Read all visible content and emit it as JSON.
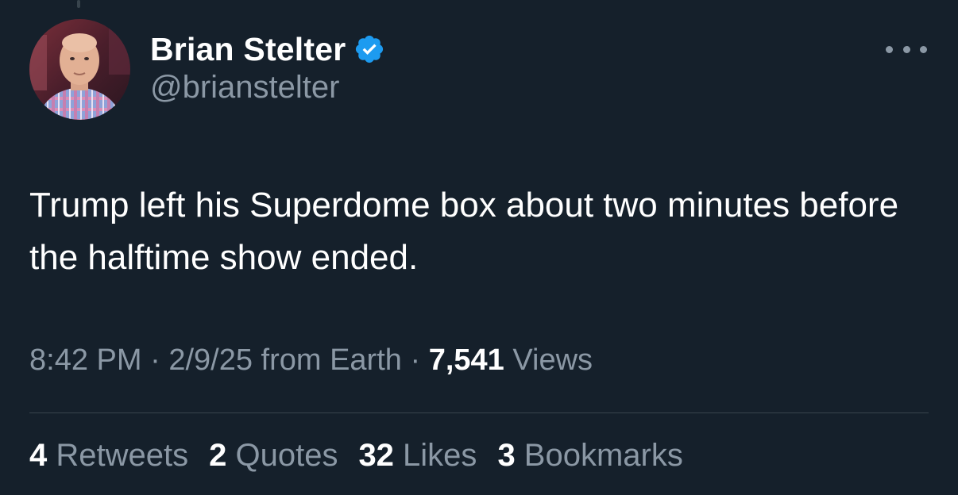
{
  "author": {
    "display_name": "Brian Stelter",
    "handle": "@brianstelter",
    "verified": true
  },
  "tweet": {
    "text": "Trump left his Superdome box about two minutes before the halftime show ended."
  },
  "meta": {
    "time": "8:42 PM",
    "sep1": " · ",
    "date_source": "2/9/25 from Earth",
    "sep2": " · ",
    "views_count": "7,541",
    "views_label": " Views"
  },
  "stats": [
    {
      "count": "4",
      "label": " Retweets"
    },
    {
      "count": "2",
      "label": " Quotes"
    },
    {
      "count": "32",
      "label": " Likes"
    },
    {
      "count": "3",
      "label": " Bookmarks"
    }
  ],
  "colors": {
    "background": "#15202b",
    "secondary_text": "#8b98a5",
    "verified_blue": "#1d9bf0",
    "divider": "#38444d"
  },
  "icons": {
    "verified": "verified-badge-icon",
    "more": "more-horizontal-icon"
  }
}
